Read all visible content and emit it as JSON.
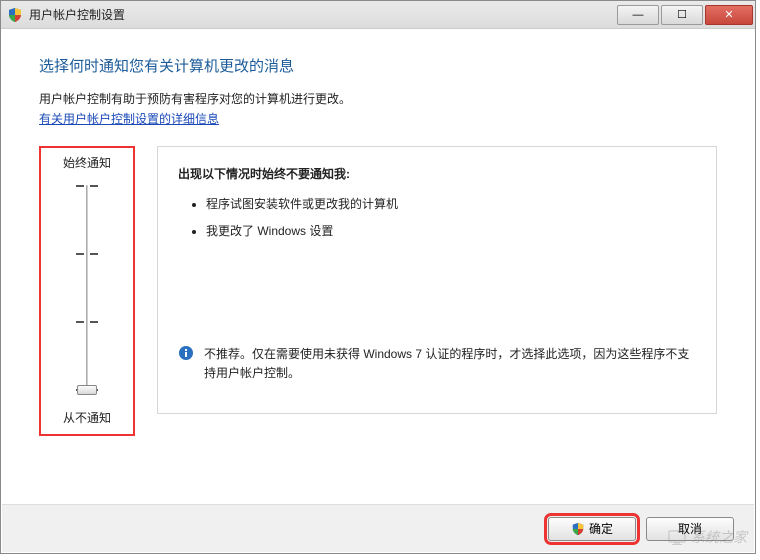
{
  "window": {
    "title": "用户帐户控制设置"
  },
  "heading": "选择何时通知您有关计算机更改的消息",
  "description": "用户帐户控制有助于预防有害程序对您的计算机进行更改。",
  "help_link": "有关用户帐户控制设置的详细信息",
  "slider": {
    "top_label": "始终通知",
    "bottom_label": "从不通知",
    "level_count": 4,
    "current_level": 0
  },
  "detail": {
    "heading": "出现以下情况时始终不要通知我:",
    "bullets": [
      "程序试图安装软件或更改我的计算机",
      "我更改了 Windows 设置"
    ],
    "info": "不推荐。仅在需要使用未获得 Windows 7 认证的程序时，才选择此选项，因为这些程序不支持用户帐户控制。"
  },
  "buttons": {
    "ok": "确定",
    "cancel": "取消"
  },
  "watermark": "系统之家"
}
